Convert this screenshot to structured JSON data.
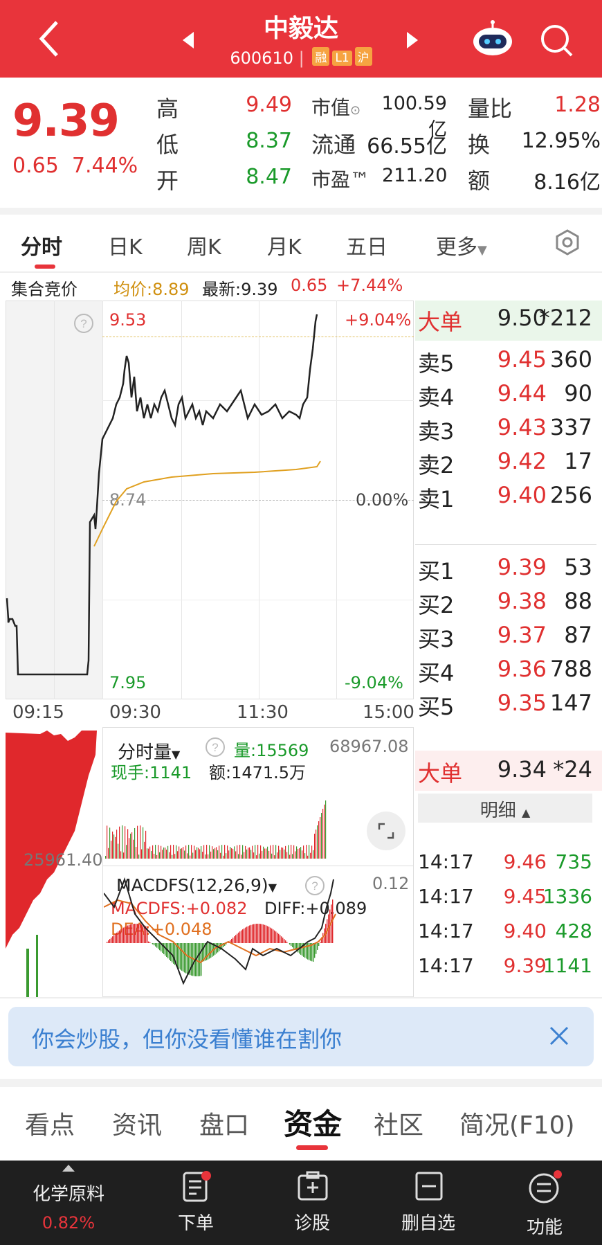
{
  "header": {
    "title": "中毅达",
    "code": "600610",
    "tags": [
      "融",
      "L1",
      "沪"
    ]
  },
  "quote": {
    "price": "9.39",
    "change": "0.65",
    "change_pct": "7.44%",
    "high_label": "高",
    "high": "9.49",
    "low_label": "低",
    "low": "8.37",
    "open_label": "开",
    "open": "8.47",
    "mktcap_label": "市值",
    "mktcap": "100.59亿",
    "float_label": "流通",
    "float": "66.55亿",
    "pe_label": "市盈™",
    "pe": "211.20",
    "volratio_label": "量比",
    "volratio": "1.28",
    "turnover_label": "换",
    "turnover": "12.95%",
    "amount_label": "额",
    "amount": "8.16亿"
  },
  "tabs": [
    "分时",
    "日K",
    "周K",
    "月K",
    "五日",
    "更多"
  ],
  "info_line": {
    "auction": "集合竞价",
    "avg": "均价:8.89",
    "latest": "最新:9.39",
    "chg": "0.65",
    "pct": "+7.44%"
  },
  "chart_labels": {
    "upper_price": "9.53",
    "upper_pct": "+9.04%",
    "mid_price": "8.74",
    "mid_pct": "0.00%",
    "lower_price": "7.95",
    "lower_pct": "-9.04%",
    "times": [
      "09:15",
      "09:30",
      "11:30",
      "15:00"
    ],
    "vol_title": "分时量",
    "vol_value": "量:15569",
    "vol_max": "68967.08",
    "cur_hand": "现手:1141",
    "amount": "额:1471.5万",
    "auction_vol": "25961.40",
    "macd_title": "MACDFS(12,26,9)",
    "macd_max": "0.12",
    "macdfs": "MACDFS:+0.082",
    "diff": "DIFF:+0.089",
    "dea": "DEA:+0.048"
  },
  "orderbook": {
    "big_top": {
      "label": "大单",
      "price": "9.50",
      "vol": "*212"
    },
    "asks": [
      {
        "label": "卖5",
        "price": "9.45",
        "vol": "360"
      },
      {
        "label": "卖4",
        "price": "9.44",
        "vol": "90"
      },
      {
        "label": "卖3",
        "price": "9.43",
        "vol": "337"
      },
      {
        "label": "卖2",
        "price": "9.42",
        "vol": "17"
      },
      {
        "label": "卖1",
        "price": "9.40",
        "vol": "256"
      }
    ],
    "bids": [
      {
        "label": "买1",
        "price": "9.39",
        "vol": "53"
      },
      {
        "label": "买2",
        "price": "9.38",
        "vol": "88"
      },
      {
        "label": "买3",
        "price": "9.37",
        "vol": "87"
      },
      {
        "label": "买4",
        "price": "9.36",
        "vol": "788"
      },
      {
        "label": "买5",
        "price": "9.35",
        "vol": "147"
      }
    ],
    "big_bottom": {
      "label": "大单",
      "price": "9.34",
      "vol": "*24"
    },
    "detail_label": "明细",
    "ticks": [
      {
        "time": "14:17",
        "price": "9.46",
        "vol": "735",
        "color": "green"
      },
      {
        "time": "14:17",
        "price": "9.45",
        "vol": "1336",
        "color": "green"
      },
      {
        "time": "14:17",
        "price": "9.40",
        "vol": "428",
        "color": "green"
      },
      {
        "time": "14:17",
        "price": "9.39",
        "vol": "1141",
        "color": "green"
      }
    ]
  },
  "banner": {
    "text": "你会炒股，但你没看懂谁在割你"
  },
  "bottom_tabs": [
    "看点",
    "资讯",
    "盘口",
    "资金",
    "社区",
    "简况(F10)"
  ],
  "bottom_tab_active": 3,
  "bottom_nav": {
    "sector": "化学原料",
    "sector_pct": "0.82%",
    "items": [
      "下单",
      "诊股",
      "删自选",
      "功能"
    ]
  },
  "colors": {
    "brand": "#e8343b",
    "up": "#e03030",
    "down": "#1a9a2a",
    "avg_line": "#e0a020"
  }
}
